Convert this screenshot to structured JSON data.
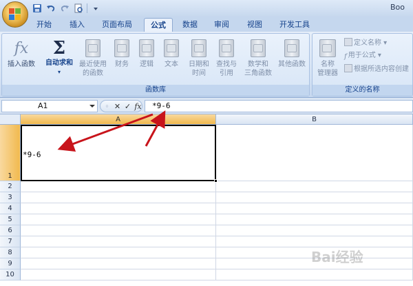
{
  "app": {
    "title": "Boo"
  },
  "tabs": [
    {
      "label": "开始"
    },
    {
      "label": "插入"
    },
    {
      "label": "页面布局"
    },
    {
      "label": "公式"
    },
    {
      "label": "数据"
    },
    {
      "label": "审阅"
    },
    {
      "label": "视图"
    },
    {
      "label": "开发工具"
    }
  ],
  "active_tab": "公式",
  "ribbon": {
    "insert_function": {
      "icon_text": "fx",
      "label": "插入函数"
    },
    "function_library": {
      "label": "函数库",
      "autosum": {
        "icon_text": "Σ",
        "label": "自动求和"
      },
      "recent": {
        "line1": "最近使用",
        "line2": "的函数"
      },
      "financial": {
        "label": "财务"
      },
      "logical": {
        "label": "逻辑"
      },
      "text": {
        "label": "文本"
      },
      "datetime": {
        "line1": "日期和",
        "line2": "时间"
      },
      "lookup": {
        "line1": "查找与",
        "line2": "引用"
      },
      "math": {
        "line1": "数学和",
        "line2": "三角函数"
      },
      "more": {
        "label": "其他函数"
      }
    },
    "defined_names": {
      "label": "定义的名称",
      "name_manager": {
        "line1": "名称",
        "line2": "管理器"
      },
      "define_name": "定义名称",
      "use_in_formula": "用于公式",
      "create_from_selection": "根据所选内容创建"
    }
  },
  "formula_bar": {
    "name_box": "A1",
    "fx": "fx",
    "value": "*9-6"
  },
  "sheet": {
    "columns": [
      "A",
      "B"
    ],
    "rows": [
      "1",
      "2",
      "3",
      "4",
      "5",
      "6",
      "7",
      "8",
      "9",
      "10"
    ],
    "a1_value": "*9-6"
  },
  "watermark": "Bai经验",
  "colors": {
    "arrow": "#c8141b",
    "selected_header": "#f1b94e",
    "ribbon_text": "#15428b"
  }
}
